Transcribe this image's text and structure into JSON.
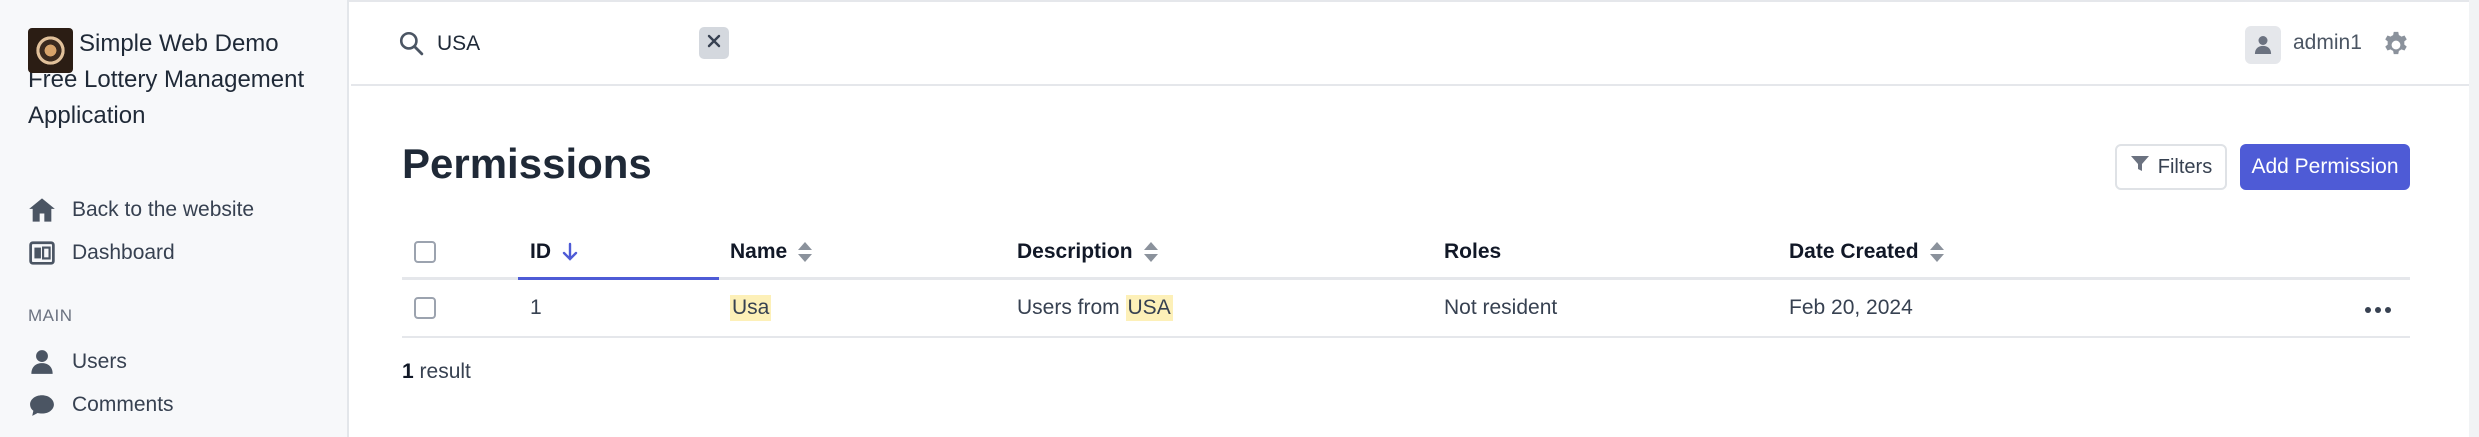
{
  "app": {
    "title_line1": "Simple Web Demo",
    "title_line2": "Free Lottery Management",
    "title_line3": "Application",
    "logo_icon": "app-logo"
  },
  "sidebar": {
    "items": [
      {
        "label": "Back to the website",
        "icon": "home-icon"
      },
      {
        "label": "Dashboard",
        "icon": "dashboard-icon"
      }
    ],
    "section_label": "MAIN",
    "main_items": [
      {
        "label": "Users",
        "icon": "user-icon"
      },
      {
        "label": "Comments",
        "icon": "comment-icon"
      }
    ]
  },
  "header": {
    "search_value": "USA",
    "clear_icon": "close-icon",
    "user_name": "admin1",
    "settings_icon": "gear-icon"
  },
  "page": {
    "title": "Permissions",
    "filters_label": "Filters",
    "add_label": "Add Permission"
  },
  "table": {
    "columns": {
      "id": "ID",
      "name": "Name",
      "description": "Description",
      "roles": "Roles",
      "date_created": "Date Created"
    },
    "rows": [
      {
        "id": "1",
        "name": "Usa",
        "description_prefix": "Users from ",
        "description_match": "USA",
        "roles": "Not resident",
        "date_created": "Feb 20, 2024"
      }
    ]
  },
  "result": {
    "count": "1",
    "label": " result"
  },
  "colors": {
    "accent": "#4e5bd6",
    "highlight": "#fdf0b8",
    "sidebar_bg": "#f7f8fa"
  }
}
